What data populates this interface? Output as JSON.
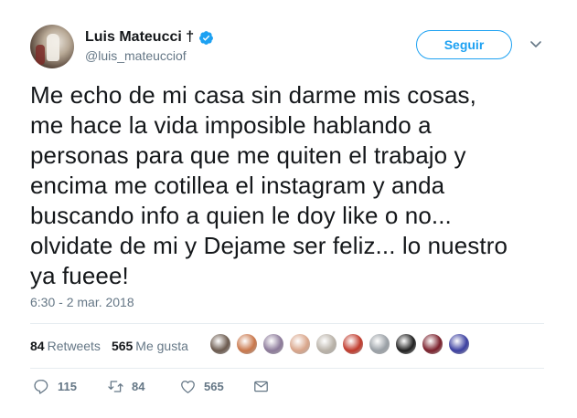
{
  "user": {
    "display_name": "Luis Mateucci †",
    "handle": "@luis_mateucciof",
    "verified": true,
    "avatar_icon": "avatar-photo"
  },
  "follow_button": {
    "label": "Seguir",
    "color": "#1da1f2"
  },
  "more_menu": {
    "icon": "chevron-down-icon"
  },
  "tweet": {
    "text": "Me echo de mi casa sin darme mis cosas,\nme hace la vida imposible hablando a\npersonas para que me quiten el trabajo y\nencima me cotillea el instagram y anda\nbuscando info a quien le doy like o no...\nolvidate de mi y Dejame ser feliz... lo nuestro\nya fueee!",
    "timestamp": "6:30 - 2 mar. 2018"
  },
  "stats": {
    "retweets_count": "84",
    "retweets_label": "Retweets",
    "likes_count": "565",
    "likes_label": "Me gusta",
    "liker_avatar_colors": [
      "#6b5a4e",
      "#c9774b",
      "#8c7a9a",
      "#d9a58a",
      "#b9b2a8",
      "#c0392b",
      "#9aa0a6",
      "#1f1f1f",
      "#7a1f2b",
      "#3b3fa0"
    ]
  },
  "actions": {
    "reply_count": "115",
    "retweet_count": "84",
    "like_count": "565",
    "reply_icon": "reply-icon",
    "retweet_icon": "retweet-icon",
    "like_icon": "heart-icon",
    "dm_icon": "envelope-icon"
  },
  "colors": {
    "text": "#14171a",
    "secondary": "#657786",
    "accent": "#1da1f2",
    "divider": "#e6ecf0"
  }
}
